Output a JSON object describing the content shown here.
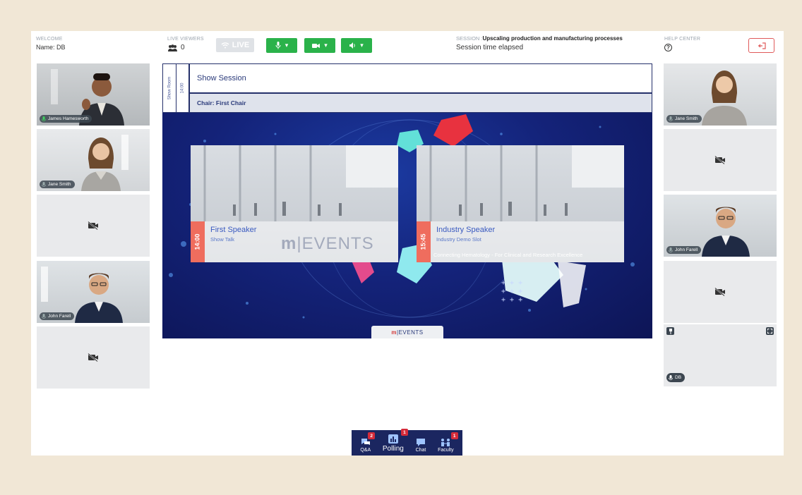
{
  "header": {
    "welcome_label": "WELCOME",
    "user_name": "Name: DB",
    "viewers_label": "LIVE VIEWERS",
    "viewers_count": "0",
    "live_label": "LIVE",
    "session_prefix": "SESSION :",
    "session_name": "Upscaling production and manufacturing processes",
    "session_time": "Session time elapsed",
    "help_label": "HELP CENTER"
  },
  "left_tiles": [
    {
      "name": "James Hamesworth",
      "video": true,
      "mic": "on"
    },
    {
      "name": "Jane Smith",
      "video": true,
      "mic": "off"
    },
    {
      "name": "",
      "video": false
    },
    {
      "name": "John Farell",
      "video": true,
      "mic": "off"
    },
    {
      "name": "",
      "video": false
    }
  ],
  "right_tiles": [
    {
      "name": "Jane Smith",
      "video": true,
      "mic": "off"
    },
    {
      "name": "",
      "video": false
    },
    {
      "name": "John Farell",
      "video": true,
      "mic": "off"
    },
    {
      "name": "",
      "video": false
    },
    {
      "name": "DB",
      "video": false,
      "self": true
    }
  ],
  "stage": {
    "room": "Show Room",
    "time": "14:00",
    "title": "Show Session",
    "chair": "Chair: First Chair",
    "slots": [
      {
        "time": "14:00",
        "speaker": "First Speaker",
        "subtitle": "Show Talk"
      },
      {
        "time": "15:45",
        "speaker": "Industry Speaker",
        "subtitle": "Industry Demo Slot"
      }
    ],
    "footer_text": "Connecting Hematology - For Clinical and Research Excellence",
    "logo_tab": "EVENTS",
    "logo_mark": "m",
    "logo_sep": "|"
  },
  "bottom_bar": {
    "qa_label": "Q&A",
    "qa_badge": "2",
    "polling_label": "Polling",
    "polling_badge": "1",
    "chat_label": "Chat",
    "faculty_label": "Faculty",
    "faculty_badge": "1"
  },
  "colors": {
    "live_green": "#2ab24a",
    "navy": "#1b2660",
    "accent_red": "#ef6d5e"
  },
  "icons": [
    "users-icon",
    "wifi-icon",
    "mic-icon",
    "camera-icon",
    "speaker-icon",
    "help-icon",
    "exit-icon",
    "camera-off-icon",
    "qa-icon",
    "polling-icon",
    "chat-icon",
    "faculty-icon"
  ]
}
